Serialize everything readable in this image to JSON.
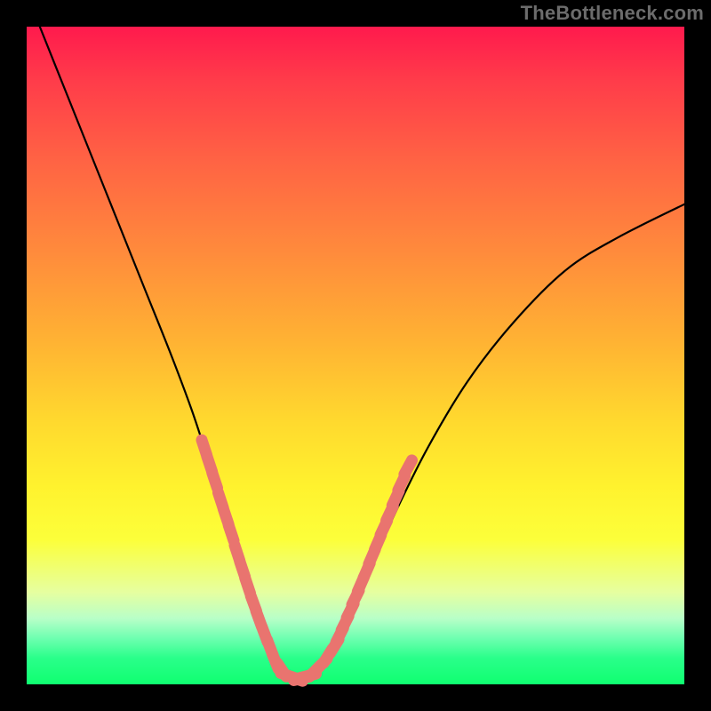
{
  "watermark": "TheBottleneck.com",
  "chart_data": {
    "type": "line",
    "title": "",
    "xlabel": "",
    "ylabel": "",
    "xlim": [
      0,
      100
    ],
    "ylim": [
      0,
      100
    ],
    "series": [
      {
        "name": "bottleneck-curve",
        "x": [
          2,
          6,
          10,
          14,
          18,
          22,
          25,
          27,
          29,
          31,
          33,
          35,
          37,
          38,
          39,
          40,
          42,
          44,
          46,
          49,
          52,
          56,
          61,
          67,
          74,
          82,
          90,
          100
        ],
        "values": [
          100,
          90,
          80,
          70,
          60,
          50,
          42,
          36,
          30,
          24,
          18,
          12,
          7,
          4,
          2,
          1,
          1,
          2,
          5,
          10,
          17,
          26,
          36,
          46,
          55,
          63,
          68,
          73
        ]
      }
    ],
    "marker_clusters": [
      {
        "name": "left-cluster",
        "side": "left",
        "points": [
          {
            "x": 27.0,
            "y": 36.0
          },
          {
            "x": 27.8,
            "y": 33.5
          },
          {
            "x": 28.6,
            "y": 31.0
          },
          {
            "x": 29.5,
            "y": 28.0
          },
          {
            "x": 30.3,
            "y": 25.5
          },
          {
            "x": 31.1,
            "y": 23.0
          },
          {
            "x": 32.0,
            "y": 20.0
          },
          {
            "x": 32.8,
            "y": 17.5
          },
          {
            "x": 33.6,
            "y": 15.0
          },
          {
            "x": 34.5,
            "y": 12.3
          },
          {
            "x": 35.3,
            "y": 10.0
          },
          {
            "x": 36.2,
            "y": 7.6
          },
          {
            "x": 37.0,
            "y": 5.6
          }
        ]
      },
      {
        "name": "bottom-cluster",
        "side": "bottom",
        "points": [
          {
            "x": 37.8,
            "y": 3.5
          },
          {
            "x": 38.8,
            "y": 2.2
          },
          {
            "x": 39.8,
            "y": 1.3
          },
          {
            "x": 40.8,
            "y": 0.9
          },
          {
            "x": 41.8,
            "y": 0.9
          },
          {
            "x": 42.8,
            "y": 1.3
          },
          {
            "x": 43.8,
            "y": 2.0
          },
          {
            "x": 44.8,
            "y": 3.0
          },
          {
            "x": 45.8,
            "y": 4.3
          },
          {
            "x": 46.8,
            "y": 5.8
          }
        ]
      },
      {
        "name": "right-cluster",
        "side": "right",
        "points": [
          {
            "x": 47.6,
            "y": 7.5
          },
          {
            "x": 48.4,
            "y": 9.3
          },
          {
            "x": 49.2,
            "y": 11.2
          },
          {
            "x": 50.0,
            "y": 13.2
          },
          {
            "x": 50.8,
            "y": 15.2
          },
          {
            "x": 51.7,
            "y": 17.3
          },
          {
            "x": 52.5,
            "y": 19.4
          },
          {
            "x": 53.4,
            "y": 21.6
          },
          {
            "x": 54.3,
            "y": 23.8
          },
          {
            "x": 55.2,
            "y": 26.0
          },
          {
            "x": 56.1,
            "y": 28.3
          },
          {
            "x": 57.0,
            "y": 30.6
          },
          {
            "x": 58.0,
            "y": 33.0
          }
        ]
      }
    ],
    "background_gradient": {
      "top": "#ff1a4d",
      "mid": "#ffe22e",
      "bottom": "#0fff70"
    },
    "grid": false,
    "legend": false
  }
}
